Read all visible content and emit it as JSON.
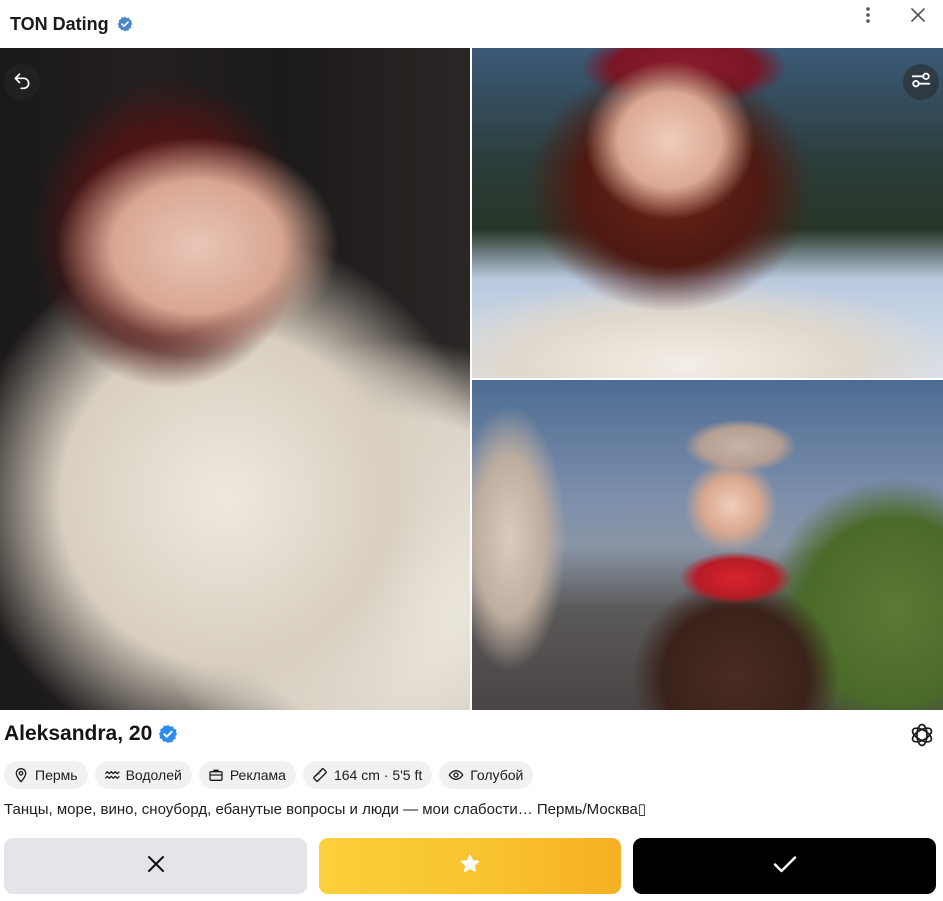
{
  "header": {
    "title": "TON Dating",
    "verified_icon": "verified-badge-icon",
    "menu_icon": "more-vertical-icon",
    "close_icon": "close-icon"
  },
  "gallery": {
    "back_icon": "undo-icon",
    "filter_icon": "filter-sliders-icon"
  },
  "profile": {
    "name_age": "Aleksandra, 20",
    "ai_icon": "openai-icon",
    "tags": [
      {
        "icon": "location-pin-icon",
        "label": "Пермь"
      },
      {
        "icon": "aquarius-icon",
        "label": "Водолей"
      },
      {
        "icon": "briefcase-icon",
        "label": "Реклама"
      },
      {
        "icon": "ruler-icon",
        "label": "164 cm · 5'5 ft"
      },
      {
        "icon": "eye-icon",
        "label": "Голубой"
      }
    ],
    "bio": "Танцы, море, вино, сноуборд, ебанутые вопросы и люди — мои слабости… Пермь/Москва▯"
  },
  "actions": {
    "dislike_icon": "x-icon",
    "superlike_icon": "star-icon",
    "like_icon": "check-icon"
  },
  "colors": {
    "verified_blue": "#2d8cf0",
    "superlike_yellow": "#f9c12e",
    "tag_bg": "#f1f1f4",
    "dislike_bg": "#e4e4e9",
    "like_bg": "#000000"
  }
}
